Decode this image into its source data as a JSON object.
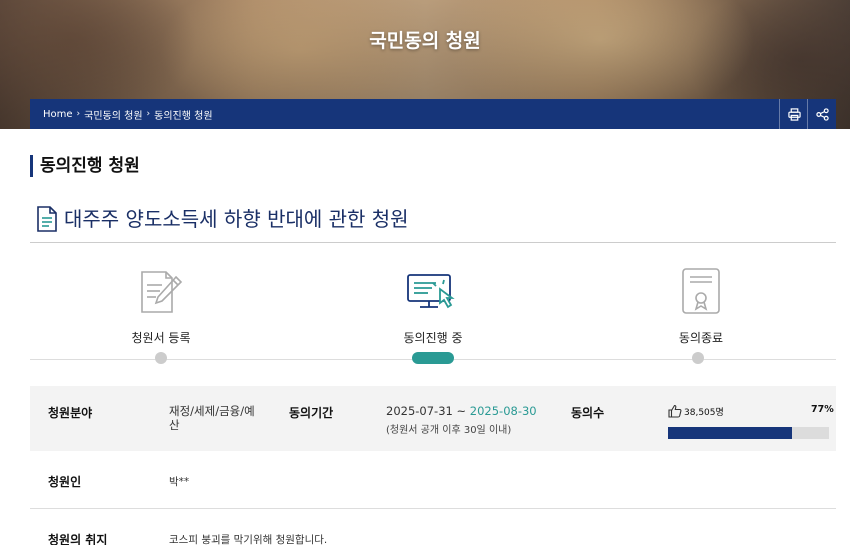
{
  "hero": {
    "title": "국민동의 청원"
  },
  "breadcrumb": {
    "home": "Home",
    "level1": "국민동의 청원",
    "level2": "동의진행 청원",
    "separator": "›"
  },
  "toolbar": {
    "print_icon": "print-icon",
    "share_icon": "share-icon"
  },
  "section": {
    "title": "동의진행 청원"
  },
  "petition": {
    "icon": "document-icon",
    "title": "대주주 양도소득세 하향 반대에 관한 청원"
  },
  "steps": [
    {
      "label": "청원서 등록",
      "icon": "pencil-document-icon",
      "state": "done"
    },
    {
      "label": "동의진행 중",
      "icon": "monitor-click-icon",
      "state": "current"
    },
    {
      "label": "동의종료",
      "icon": "certificate-icon",
      "state": "pending"
    }
  ],
  "info": {
    "field_label": "청원분야",
    "field_value_line1": "재정/세제/금융/예",
    "field_value_line2": "산",
    "period_label": "동의기간",
    "period_start": "2025-07-31 ~ ",
    "period_end": "2025-08-30",
    "period_note": "(청원서 공개 이후 30일 이내)",
    "votes_label": "동의수",
    "votes_count": "38,505명",
    "votes_percent_text": "77%",
    "votes_percent": 77,
    "petitioner_label": "청원인",
    "petitioner_value": "박**",
    "purpose_label": "청원의 취지",
    "purpose_value": "코스피 붕괴를 막기위해 청원합니다."
  },
  "colors": {
    "navy": "#16357a",
    "teal": "#2a9a94",
    "gray_bar": "#dcdcdc"
  }
}
